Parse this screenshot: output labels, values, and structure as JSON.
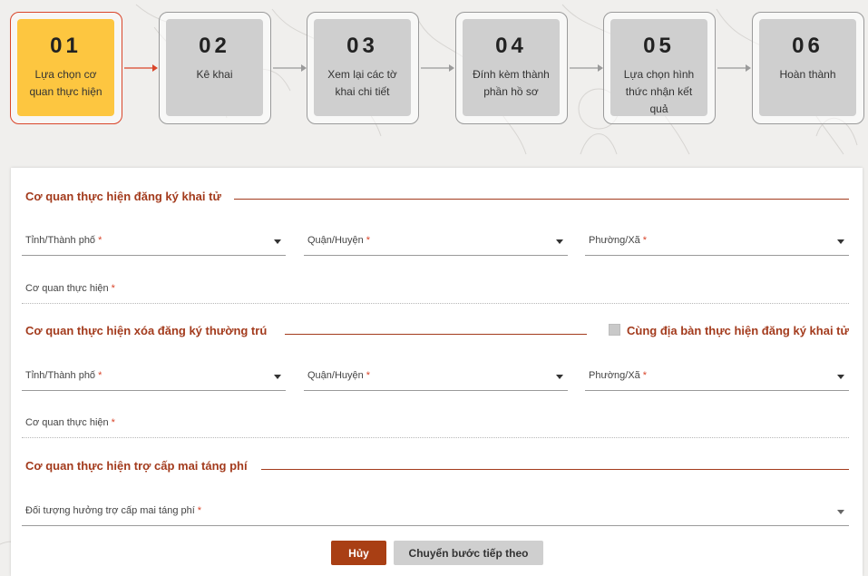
{
  "steps": [
    {
      "num": "01",
      "label": "Lựa chọn cơ quan thực hiện",
      "active": true
    },
    {
      "num": "02",
      "label": "Kê khai",
      "active": false
    },
    {
      "num": "03",
      "label": "Xem lại các tờ khai chi tiết",
      "active": false
    },
    {
      "num": "04",
      "label": "Đính kèm thành phần hồ sơ",
      "active": false
    },
    {
      "num": "05",
      "label": "Lựa chọn hình thức nhận kết quả",
      "active": false
    },
    {
      "num": "06",
      "label": "Hoàn thành",
      "active": false
    }
  ],
  "colors": {
    "accent": "#a33b1d",
    "active_step": "#fdc640",
    "active_border": "#d9452a",
    "inactive_step": "#cfcfcf",
    "cancel_button": "#a93f14",
    "next_button": "#cfcfcf"
  },
  "section1": {
    "title": "Cơ quan thực hiện đăng ký khai tử",
    "province_label": "Tỉnh/Thành phố",
    "district_label": "Quận/Huyện",
    "ward_label": "Phường/Xã",
    "agency_label": "Cơ quan thực hiện",
    "required_mark": "*"
  },
  "section2": {
    "title": "Cơ quan thực hiện xóa đăng ký thường trú",
    "same_area_checkbox_label": "Cùng địa bàn thực hiện đăng ký khai tử",
    "same_area_checked": false,
    "province_label": "Tỉnh/Thành phố",
    "district_label": "Quận/Huyện",
    "ward_label": "Phường/Xã",
    "agency_label": "Cơ quan thực hiện",
    "required_mark": "*"
  },
  "section3": {
    "title": "Cơ quan thực hiện trợ cấp mai táng phí",
    "beneficiary_label": "Đối tượng hưởng trợ cấp mai táng phí",
    "required_mark": "*"
  },
  "buttons": {
    "cancel": "Hủy",
    "next": "Chuyển bước tiếp theo"
  }
}
